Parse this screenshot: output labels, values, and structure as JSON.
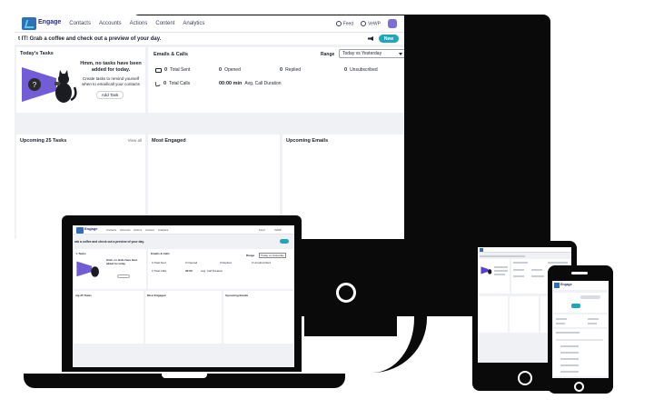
{
  "app": {
    "brand": "Engage",
    "nav": [
      "Contacts",
      "Accounts",
      "Actions",
      "Content",
      "Analytics"
    ],
    "feed_label": "Feed",
    "user_label": "VeWP"
  },
  "greeting": {
    "text": "t IT! Grab a coffee and check out a preview of your day.",
    "new_button": "New"
  },
  "tasks": {
    "title": "Today's Tasks",
    "empty_title": "Hmm, no tasks have been added for today.",
    "empty_sub": "Create tasks to remind yourself when to email/call your contacts",
    "add_button": "Add Task"
  },
  "emails_calls": {
    "title": "Emails & Calls",
    "range_label": "Range",
    "range_value": "Today vs Yesterday",
    "total_sent_value": "0",
    "total_sent_label": "Total Sent",
    "opened_value": "0",
    "opened_label": "Opened",
    "replied_value": "0",
    "replied_label": "Replied",
    "unsubscribed_value": "0",
    "unsubscribed_label": "Unsubscribed",
    "total_calls_value": "0",
    "total_calls_label": "Total Calls",
    "avg_duration_value": "00:00 min",
    "avg_duration_label": "Avg. Call Duration"
  },
  "panels": {
    "upcoming_tasks": "Upcoming 25 Tasks",
    "view_all": "View all",
    "most_engaged": "Most Engaged",
    "upcoming_emails": "Upcoming Emails"
  },
  "laptop": {
    "brand": "Engage",
    "greeting": "rab a coffee and check out a preview of your day.",
    "tasks_title": "'s Tasks",
    "empty_title": "Hmm, no tasks have been added for today",
    "emails_title": "Emails & Calls",
    "range_label": "Range",
    "range_value": "Today vs Yesterday",
    "total_sent": "Total Sent",
    "opened": "Opened",
    "replied": "Replied",
    "unsubscribed": "Unsubscribed",
    "total_calls": "Total Calls",
    "avg_value": "00:00",
    "avg_label": "Avg. Call Duration",
    "upcoming_tasks": "ing 25 Tasks",
    "most_engaged": "Most Engaged",
    "upcoming_emails": "Upcoming Emails"
  },
  "phone": {
    "brand": "Engage"
  },
  "colors": {
    "accent": "#1fa7b8",
    "brand_blue": "#2f6fb8",
    "avatar": "#7b6fd6",
    "device": "#0a0a0a",
    "illustration_purple": "#5b3fd0"
  }
}
